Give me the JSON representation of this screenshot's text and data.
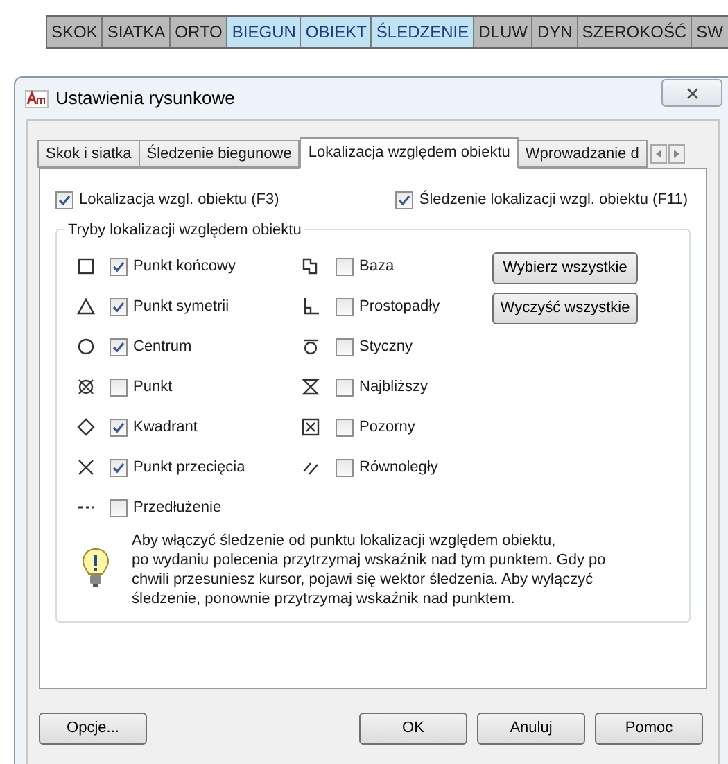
{
  "status_bar": [
    {
      "label": "SKOK",
      "selected": false
    },
    {
      "label": "SIATKA",
      "selected": false
    },
    {
      "label": "ORTO",
      "selected": false
    },
    {
      "label": "BIEGUN",
      "selected": true
    },
    {
      "label": "OBIEKT",
      "selected": true
    },
    {
      "label": "ŚLEDZENIE",
      "selected": true
    },
    {
      "label": "DLUW",
      "selected": false
    },
    {
      "label": "DYN",
      "selected": false
    },
    {
      "label": "SZEROKOŚĆ",
      "selected": false
    },
    {
      "label": "SW",
      "selected": false
    }
  ],
  "dialog": {
    "title": "Ustawienia rysunkowe",
    "tabs": [
      {
        "label": "Skok i siatka",
        "selected": false
      },
      {
        "label": "Śledzenie biegunowe",
        "selected": false
      },
      {
        "label": "Lokalizacja względem obiektu",
        "selected": true
      },
      {
        "label": "Wprowadzanie d",
        "selected": false
      }
    ],
    "top_checks": [
      {
        "label": "Lokalizacja wzgl. obiektu (F3)",
        "checked": true
      },
      {
        "label": "Śledzenie lokalizacji wzgl. obiektu (F11)",
        "checked": true
      }
    ],
    "group": {
      "title": "Tryby lokalizacji względem obiektu",
      "left": [
        {
          "kind": "endpoint",
          "label": "Punkt końcowy",
          "checked": true
        },
        {
          "kind": "midpoint",
          "label": "Punkt symetrii",
          "checked": true
        },
        {
          "kind": "center",
          "label": "Centrum",
          "checked": true
        },
        {
          "kind": "node",
          "label": "Punkt",
          "checked": false
        },
        {
          "kind": "quadrant",
          "label": "Kwadrant",
          "checked": true
        },
        {
          "kind": "intersection",
          "label": "Punkt przecięcia",
          "checked": true
        },
        {
          "kind": "extension",
          "label": "Przedłużenie",
          "checked": false
        }
      ],
      "right": [
        {
          "kind": "insertion",
          "label": "Baza",
          "checked": false
        },
        {
          "kind": "perpendicular",
          "label": "Prostopadły",
          "checked": false
        },
        {
          "kind": "tangent",
          "label": "Styczny",
          "checked": false
        },
        {
          "kind": "nearest",
          "label": "Najbliższy",
          "checked": false
        },
        {
          "kind": "apparent",
          "label": "Pozorny",
          "checked": false
        },
        {
          "kind": "parallel",
          "label": "Równoległy",
          "checked": false
        }
      ],
      "buttons": [
        "Wybierz wszystkie",
        "Wyczyść wszystkie"
      ],
      "hint": "Aby włączyć śledzenie od punktu lokalizacji względem obiektu,\npo wydaniu polecenia przytrzymaj wskaźnik nad tym punktem. Gdy po\nchwili przesuniesz kursor, pojawi się wektor śledzenia. Aby wyłączyć\nśledzenie, ponownie przytrzymaj wskaźnik nad punktem."
    },
    "options_button": "Opcje...",
    "action_buttons": [
      "OK",
      "Anuluj",
      "Pomoc"
    ]
  }
}
